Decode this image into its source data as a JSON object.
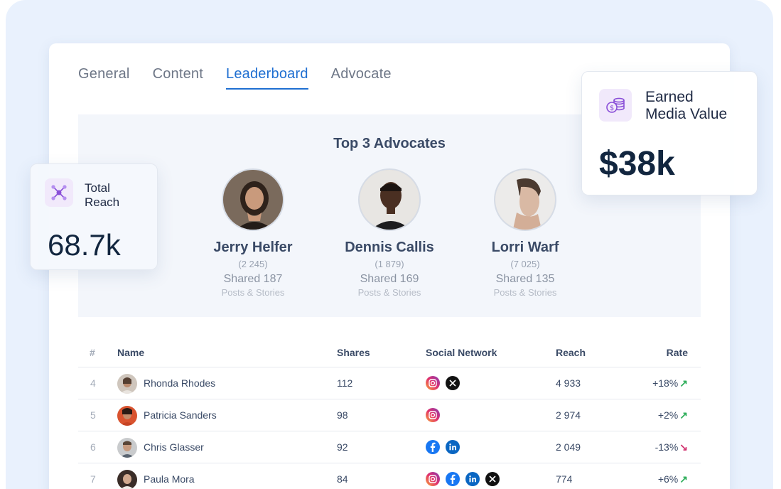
{
  "tabs": [
    {
      "label": "General",
      "active": false
    },
    {
      "label": "Content",
      "active": false
    },
    {
      "label": "Leaderboard",
      "active": true
    },
    {
      "label": "Advocate",
      "active": false
    }
  ],
  "top3": {
    "title": "Top 3 Advocates",
    "advocates": [
      {
        "name": "Jerry Helfer",
        "count": "(2 245)",
        "shared": "Shared 187",
        "posts": "Posts & Stories"
      },
      {
        "name": "Dennis Callis",
        "count": "(1 879)",
        "shared": "Shared 169",
        "posts": "Posts & Stories"
      },
      {
        "name": "Lorri Warf",
        "count": "(7 025)",
        "shared": "Shared 135",
        "posts": "Posts & Stories"
      }
    ]
  },
  "table": {
    "headers": {
      "num": "#",
      "name": "Name",
      "shares": "Shares",
      "social": "Social Network",
      "reach": "Reach",
      "rate": "Rate"
    },
    "rows": [
      {
        "num": "4",
        "name": "Rhonda Rhodes",
        "shares": "112",
        "networks": [
          "instagram",
          "x"
        ],
        "reach": "4 933",
        "rate": "+18%",
        "trend": "up"
      },
      {
        "num": "5",
        "name": "Patricia Sanders",
        "shares": "98",
        "networks": [
          "instagram"
        ],
        "reach": "2 974",
        "rate": "+2%",
        "trend": "up"
      },
      {
        "num": "6",
        "name": "Chris Glasser",
        "shares": "92",
        "networks": [
          "facebook",
          "linkedin"
        ],
        "reach": "2 049",
        "rate": "-13%",
        "trend": "down"
      },
      {
        "num": "7",
        "name": "Paula Mora",
        "shares": "84",
        "networks": [
          "instagram",
          "facebook",
          "linkedin",
          "x"
        ],
        "reach": "774",
        "rate": "+6%",
        "trend": "up"
      }
    ]
  },
  "total_reach": {
    "label_line1": "Total",
    "label_line2": "Reach",
    "value": "68.7k",
    "icon": "network-icon"
  },
  "earned_media": {
    "label_line1": "Earned",
    "label_line2": "Media Value",
    "value": "$38k",
    "icon": "coins-icon"
  },
  "colors": {
    "accent": "#1f6fd1",
    "up": "#2fae5b",
    "down": "#d1326f",
    "icon_purple": "#8a4fd8"
  }
}
